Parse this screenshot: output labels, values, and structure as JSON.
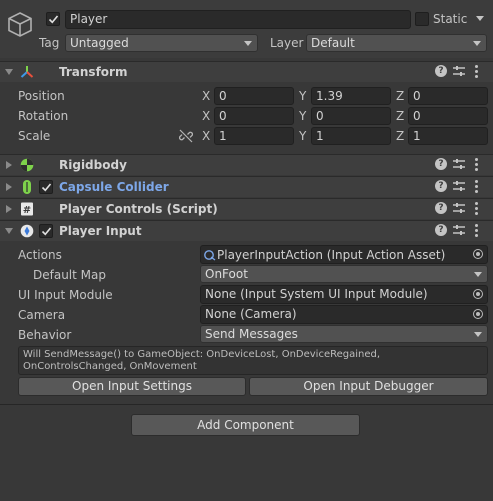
{
  "header": {
    "object_active": true,
    "object_name": "Player",
    "static_label": "Static",
    "static_checked": false,
    "tag_label": "Tag",
    "tag_value": "Untagged",
    "layer_label": "Layer",
    "layer_value": "Default"
  },
  "transform": {
    "title": "Transform",
    "rows": [
      {
        "label": "Position",
        "x": "0",
        "y": "1.39",
        "z": "0"
      },
      {
        "label": "Rotation",
        "x": "0",
        "y": "0",
        "z": "0"
      },
      {
        "label": "Scale",
        "x": "1",
        "y": "1",
        "z": "1"
      }
    ],
    "axis_x": "X",
    "axis_y": "Y",
    "axis_z": "Z"
  },
  "components": [
    {
      "title": "Rigidbody",
      "icon": "rigidbody-icon",
      "has_checkbox": false
    },
    {
      "title": "Capsule Collider",
      "icon": "capsule-collider-icon",
      "has_checkbox": true,
      "checked": true
    },
    {
      "title": "Player Controls (Script)",
      "icon": "script-icon",
      "has_checkbox": false
    },
    {
      "title": "Player Input",
      "icon": "player-input-icon",
      "has_checkbox": true,
      "checked": true
    }
  ],
  "player_input": {
    "actions_label": "Actions",
    "actions_value": "PlayerInputAction (Input Action Asset)",
    "default_map_label": "Default Map",
    "default_map_value": "OnFoot",
    "ui_module_label": "UI Input Module",
    "ui_module_value": "None (Input System UI Input Module)",
    "camera_label": "Camera",
    "camera_value": "None (Camera)",
    "behavior_label": "Behavior",
    "behavior_value": "Send Messages",
    "help_text": "Will SendMessage() to GameObject: OnDeviceLost, OnDeviceRegained, OnControlsChanged, OnMovement",
    "open_settings_label": "Open Input Settings",
    "open_debugger_label": "Open Input Debugger"
  },
  "add_component_label": "Add Component",
  "colors": {
    "panel_bg": "#383838",
    "header_bg": "#3e3e3e",
    "field_bg": "#2a2a2a",
    "link_blue": "#7da7e8"
  }
}
